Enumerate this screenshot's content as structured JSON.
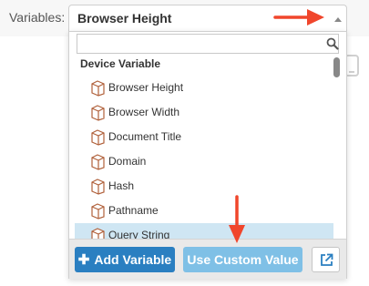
{
  "variables_label": "Variables:",
  "select": {
    "value": "Browser Height"
  },
  "search": {
    "value": "",
    "placeholder": ""
  },
  "group": {
    "label": "Device Variable"
  },
  "items": [
    {
      "label": "Browser Height"
    },
    {
      "label": "Browser Width"
    },
    {
      "label": "Document Title"
    },
    {
      "label": "Domain"
    },
    {
      "label": "Hash"
    },
    {
      "label": "Pathname"
    },
    {
      "label": "Query String"
    }
  ],
  "footer": {
    "add_label": "Add Variable",
    "custom_label": "Use Custom Value"
  },
  "colors": {
    "primary": "#2a7fc1",
    "secondary": "#7fc0e6",
    "selected_row": "#cfe6f3",
    "annotation_arrow": "#f0462c"
  },
  "icons": [
    "caret-up-icon",
    "search-icon",
    "cube-icon",
    "plus-icon",
    "external-link-icon",
    "mobile-device-icon",
    "annotation-arrow"
  ]
}
